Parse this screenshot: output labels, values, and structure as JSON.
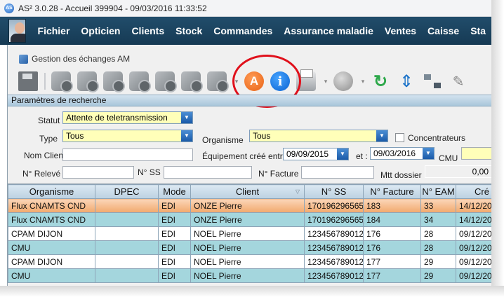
{
  "window": {
    "title": "AS² 3.0.28 - Accueil 399904 - 09/03/2016 11:33:52",
    "app_icon": "AS"
  },
  "menu": [
    "Fichier",
    "Opticien",
    "Clients",
    "Stock",
    "Commandes",
    "Assurance maladie",
    "Ventes",
    "Caisse",
    "Sta"
  ],
  "child_window": {
    "title": "Gestion des échanges AM"
  },
  "toolbar": {
    "icons": [
      "save-icon",
      "gear-icon",
      "gear-lock-icon",
      "gear-check-icon",
      "gear-edit-icon",
      "gear-doc-icon",
      "gear-doc2-icon",
      "gear-dropdown-icon",
      "a-icon",
      "info-icon",
      "printer-icon",
      "record-icon",
      "refresh-icon",
      "up-down-icon",
      "network-icon",
      "edit-icon"
    ],
    "a_label": "A",
    "info_label": "i",
    "dropdown_glyph": "▾",
    "refresh_glyph": "↻",
    "updown_glyph": "⇕",
    "edit_glyph": "✎",
    "highlight_color": "#e0101b"
  },
  "params": {
    "header": "Paramètres de recherche",
    "statut_label": "Statut",
    "statut_value": "Attente de teletransmission",
    "type_label": "Type",
    "type_value": "Tous",
    "organisme_label": "Organisme",
    "organisme_value": "Tous",
    "concentrateurs_label": "Concentrateurs",
    "nom_client_label": "Nom Client",
    "nom_client_value": "",
    "equipement_label": "Équipement créé entre :",
    "date_from": "09/09/2015",
    "et_label": "et :",
    "date_to": "09/03/2016",
    "cmu_label": "CMU",
    "cmu_value": "",
    "releve_label": "N° Relevé",
    "releve_value": "",
    "ss_label": "N° SS",
    "ss_value": "",
    "facture_label": "N° Facture",
    "facture_value": "",
    "mtt_label": "Mtt dossier",
    "mtt_value": "0,00"
  },
  "table": {
    "columns": [
      "Organisme",
      "DPEC",
      "Mode",
      "Client",
      "N° SS",
      "N° Facture",
      "N° EAM",
      "Cré"
    ],
    "client_sort_glyph": "▽",
    "rows": [
      [
        "Flux CNAMTS CND",
        "",
        "EDI",
        "ONZE Pierre",
        "170196296565",
        "183",
        "33",
        "14/12/20"
      ],
      [
        "Flux CNAMTS CND",
        "",
        "EDI",
        "ONZE Pierre",
        "170196296565",
        "184",
        "34",
        "14/12/20"
      ],
      [
        "CPAM DIJON",
        "",
        "EDI",
        "NOEL Pierre",
        "123456789012",
        "176",
        "28",
        "09/12/20"
      ],
      [
        "CMU",
        "",
        "EDI",
        "NOEL Pierre",
        "123456789012",
        "176",
        "28",
        "09/12/20"
      ],
      [
        "CPAM DIJON",
        "",
        "EDI",
        "NOEL Pierre",
        "123456789012",
        "177",
        "29",
        "09/12/20"
      ],
      [
        "CMU",
        "",
        "EDI",
        "NOEL Pierre",
        "123456789012",
        "177",
        "29",
        "09/12/20"
      ]
    ]
  }
}
